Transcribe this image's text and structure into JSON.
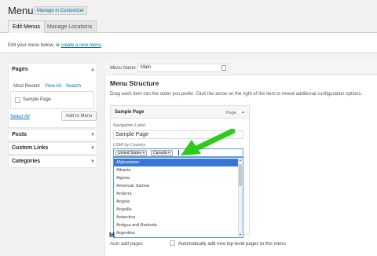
{
  "header": {
    "title": "Menus",
    "customizer_button": "Manage in Customizer"
  },
  "tabs": [
    {
      "label": "Edit Menus",
      "active": true
    },
    {
      "label": "Manage Locations",
      "active": false
    }
  ],
  "notice": {
    "text": "Edit your menu below, or",
    "link": "create a new menu",
    "end": "."
  },
  "sidebar": {
    "pages": {
      "title": "Pages",
      "tabs": [
        "Most Recent",
        "View All",
        "Search"
      ],
      "items": [
        "Sample Page"
      ],
      "select_all": "Select All",
      "add_button": "Add to Menu"
    },
    "accordion": [
      "Posts",
      "Custom Links",
      "Categories"
    ]
  },
  "menu": {
    "name_label": "Menu Name",
    "name_value": "Main",
    "structure_title": "Menu Structure",
    "instructions": "Drag each item into the order you prefer. Click the arrow on the right of the item to reveal additional configuration options.",
    "item": {
      "title": "Sample Page",
      "type": "Page",
      "nav_label_caption": "Navigation Label",
      "nav_label_value": "Sample Page",
      "lsmi_caption": "LSMI by Country",
      "selected_tags": [
        "United States",
        "Canada"
      ],
      "options": [
        "Afghanistan",
        "Albania",
        "Algeria",
        "American Samoa",
        "Andorra",
        "Angola",
        "Anguilla",
        "Antarctica",
        "Antigua and Barbuda",
        "Argentina"
      ],
      "highlighted_option": "Afghanistan"
    },
    "settings_heading_fragment": "M",
    "auto_add_label": "Auto add pages",
    "auto_add_text": "Automatically add new top-level pages to this menu"
  },
  "colors": {
    "link": "#0073aa",
    "highlight": "#3875d7",
    "arrow": "#2ecc1a"
  },
  "icons": {
    "collapse": "triangle-up",
    "expand": "triangle-down",
    "tag_remove": "×"
  }
}
